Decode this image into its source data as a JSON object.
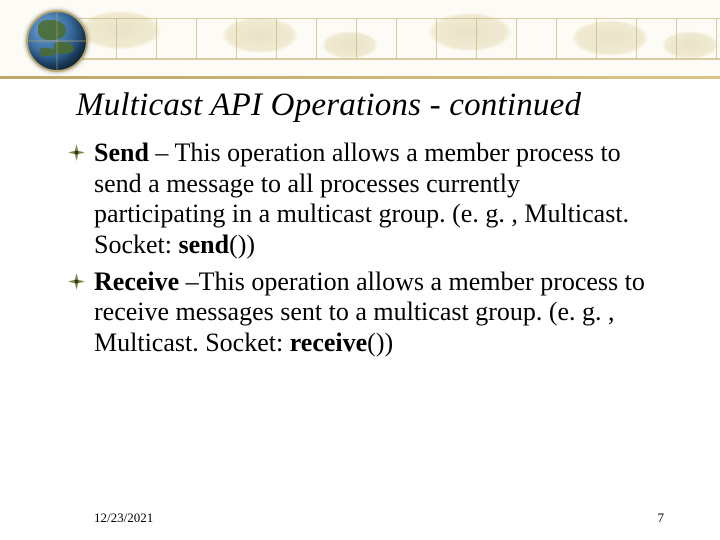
{
  "title": "Multicast API Operations - continued",
  "bullets": [
    {
      "term": "Send",
      "sep": " – ",
      "text_a": "This operation allows a member process to send a message to all processes currently participating in a multicast group. (e. g. , Multicast. Socket: ",
      "method": "send",
      "text_b": "())"
    },
    {
      "term": "Receive",
      "sep": " –",
      "text_a": "This operation allows a member process to receive messages sent to a multicast group. (e. g. , Multicast. Socket: ",
      "method": "receive",
      "text_b": "())"
    }
  ],
  "footer": {
    "date": "12/23/2021",
    "page": "7"
  }
}
